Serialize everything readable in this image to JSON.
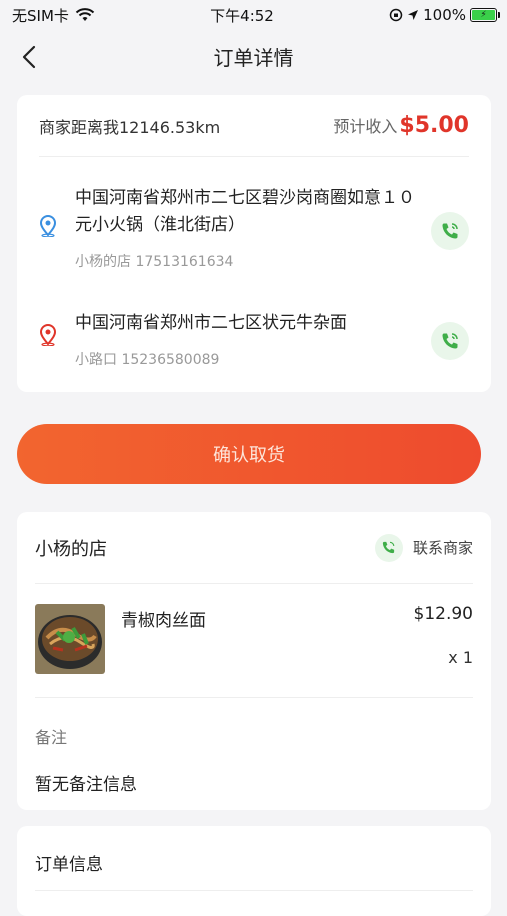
{
  "status_bar": {
    "carrier": "无SIM卡",
    "time": "下午4:52",
    "battery": "100%"
  },
  "nav": {
    "title": "订单详情"
  },
  "delivery": {
    "distance": "商家距离我12146.53km",
    "income_label": "预计收入",
    "income_value": "$5.00",
    "pickup": {
      "address": "中国河南省郑州市二七区碧沙岗商圈如意１０元小火锅（淮北街店）",
      "contact": "小杨的店 17513161634"
    },
    "dropoff": {
      "address": "中国河南省郑州市二七区状元牛杂面",
      "contact": "小路口 15236580089"
    }
  },
  "actions": {
    "confirm_pickup": "确认取货"
  },
  "shop": {
    "name": "小杨的店",
    "contact_label": "联系商家",
    "items": [
      {
        "name": "青椒肉丝面",
        "price": "$12.90",
        "qty": "x 1"
      }
    ],
    "note_label": "备注",
    "note_text": "暂无备注信息"
  },
  "order_info": {
    "title": "订单信息"
  },
  "colors": {
    "accent": "#ee4b2e",
    "price_red": "#e0352a",
    "phone_green": "#3fae49",
    "pickup_pin": "#3a8fe0",
    "dropoff_pin": "#e0352a"
  }
}
